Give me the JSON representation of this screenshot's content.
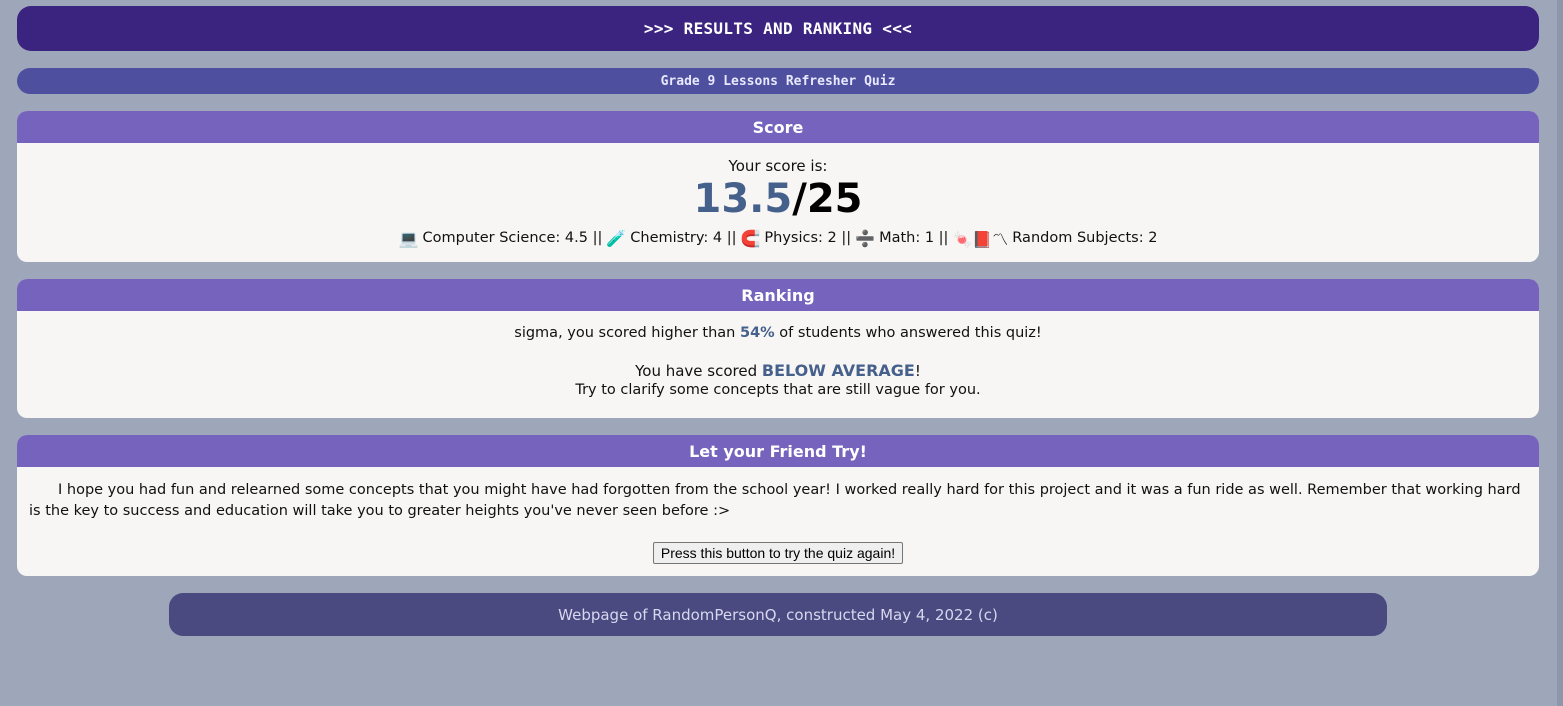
{
  "header": {
    "title": ">>> RESULTS AND RANKING <<<",
    "subtitle": "Grade 9 Lessons Refresher Quiz"
  },
  "score": {
    "heading": "Score",
    "intro": "Your score is:",
    "value": "13.5",
    "total": "/25",
    "subjects": [
      {
        "icon": "laptop-icon",
        "glyph": "💻",
        "text": "Computer Science: 4.5 ||"
      },
      {
        "icon": "test-tube-icon",
        "glyph": "🧪",
        "text": "Chemistry: 4 ||"
      },
      {
        "icon": "magnet-icon",
        "glyph": "🧲",
        "text": "Physics: 2 ||"
      },
      {
        "icon": "divide-icon",
        "glyph": "➗",
        "text": "Math: 1 ||"
      },
      {
        "icon": "random-subjects-icon",
        "glyph": "🍬📕〽",
        "text": "Random Subjects: 2"
      }
    ]
  },
  "ranking": {
    "heading": "Ranking",
    "line1_before": "sigma, you scored higher than ",
    "percent": "54%",
    "line1_after": " of students who answered this quiz!",
    "line2_before": "You have scored ",
    "level": "BELOW AVERAGE",
    "line2_after": "!",
    "line3": "Try to clarify some concepts that are still vague for you."
  },
  "friend": {
    "heading": "Let your Friend Try!",
    "message": "I hope you had fun and relearned some concepts that you might have had forgotten from the school year! I worked really hard for this project and it was a fun ride as well. Remember that working hard is the key to success and education will take you to greater heights you've never seen before :>",
    "button_label": "Press this button to try the quiz again!"
  },
  "footer": {
    "text": "Webpage of RandomPersonQ, constructed May 4, 2022 (c)"
  }
}
